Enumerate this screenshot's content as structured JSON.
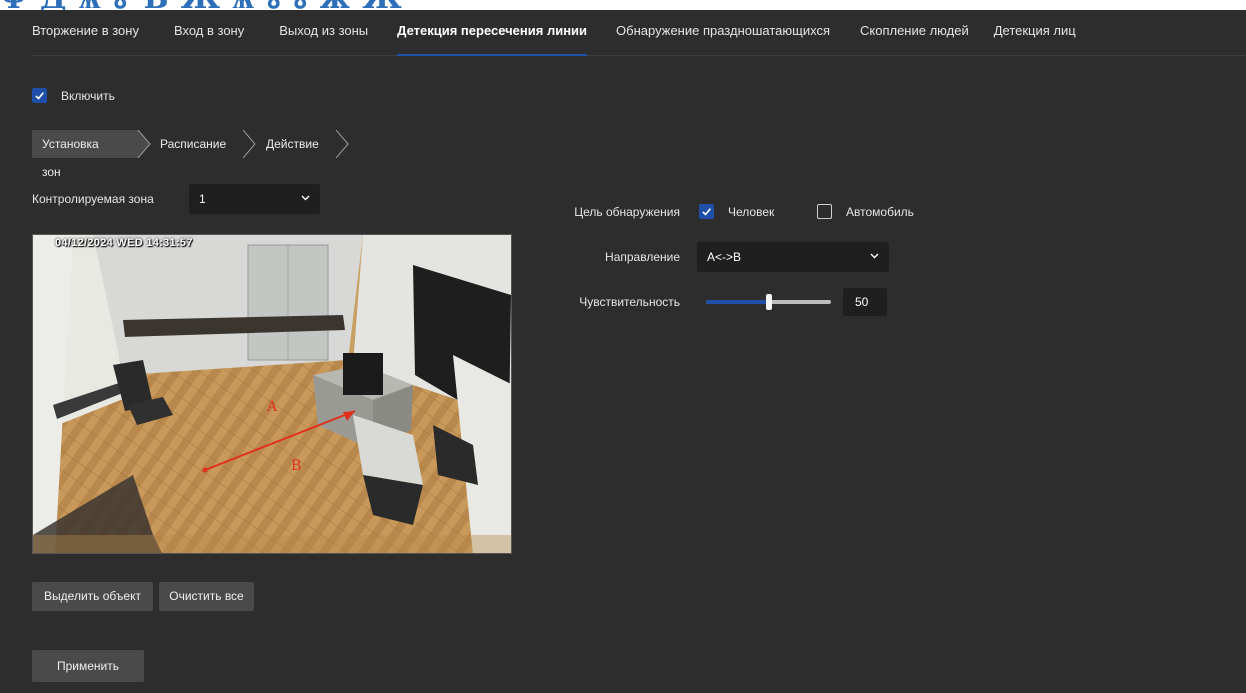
{
  "tabs": [
    {
      "label": "Вторжение в зону",
      "active": false
    },
    {
      "label": "Вход в зону",
      "active": false
    },
    {
      "label": "Выход из зоны",
      "active": false
    },
    {
      "label": "Детекция пересечения линии",
      "active": true
    },
    {
      "label": "Обнаружение праздношатающихся",
      "active": false
    },
    {
      "label": "Скопление людей",
      "active": false
    },
    {
      "label": "Детекция лиц",
      "active": false
    }
  ],
  "enable": {
    "label": "Включить",
    "checked": true
  },
  "steps": [
    {
      "label": "Установка зон",
      "active": true
    },
    {
      "label": "Расписание",
      "active": false
    },
    {
      "label": "Действие",
      "active": false
    }
  ],
  "zone": {
    "label": "Контролируемая зона",
    "value": "1"
  },
  "video": {
    "osd": "04/12/2024 WED 14:31:57",
    "point_a": "A",
    "point_b": "B"
  },
  "buttons": {
    "select_object": "Выделить объект",
    "clear_all": "Очистить все",
    "apply": "Применить"
  },
  "target": {
    "label": "Цель обнаружения",
    "person": {
      "label": "Человек",
      "checked": true
    },
    "vehicle": {
      "label": "Автомобиль",
      "checked": false
    }
  },
  "direction": {
    "label": "Направление",
    "value": "A<->B"
  },
  "sensitivity": {
    "label": "Чувствительность",
    "value": "50",
    "level": 0.5
  },
  "colors": {
    "accent": "#1f4fa8",
    "background": "#2d2d2d",
    "line": "#e0301e"
  }
}
